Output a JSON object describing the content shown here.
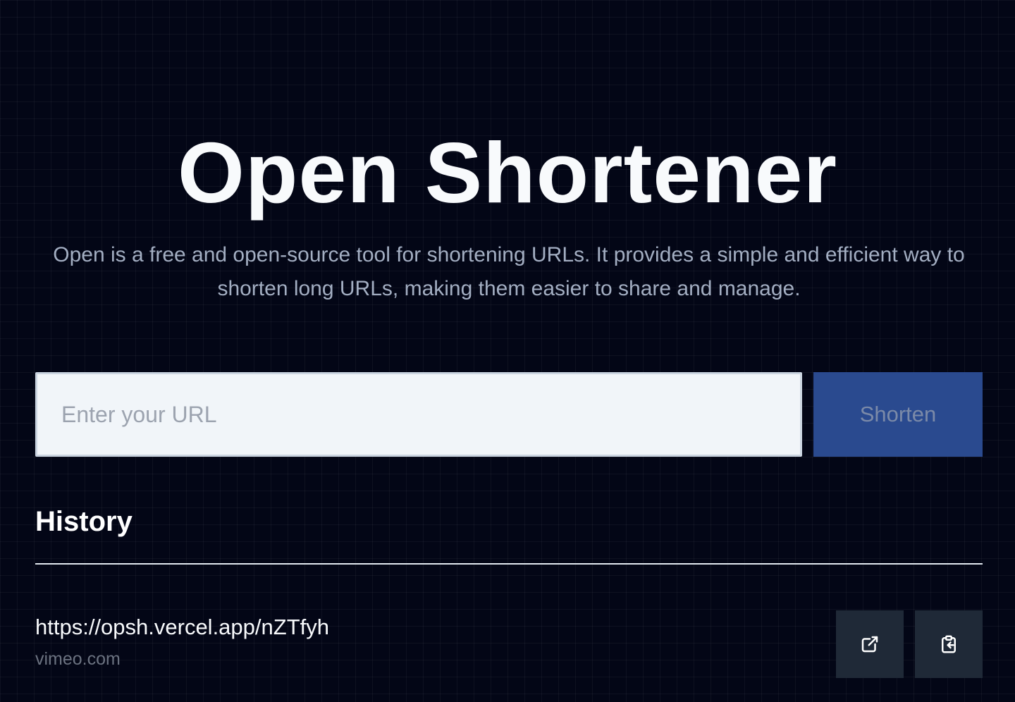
{
  "hero": {
    "title": "Open Shortener",
    "description": "Open is a free and open-source tool for shortening URLs. It provides a simple and efficient way to shorten long URLs, making them easier to share and manage."
  },
  "form": {
    "url_placeholder": "Enter your URL",
    "url_value": "",
    "shorten_label": "Shorten"
  },
  "history": {
    "title": "History",
    "items": [
      {
        "short_url": "https://opsh.vercel.app/nZTfyh",
        "host": "vimeo.com",
        "open_icon": "external-link-icon",
        "copy_icon": "clipboard-copy-icon"
      }
    ]
  },
  "colors": {
    "background": "#030616",
    "accent": "#2a4a8f",
    "input_background": "#f1f5f9",
    "icon_button_background": "#1f2937"
  }
}
